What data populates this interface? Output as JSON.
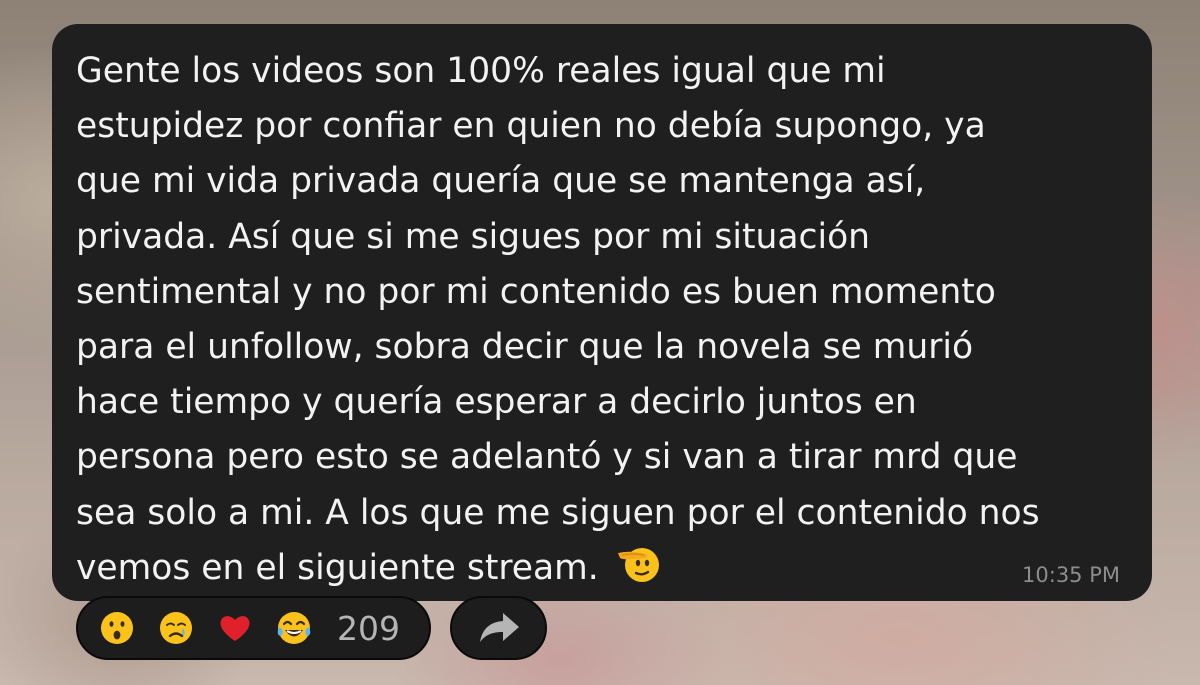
{
  "message": {
    "lines": [
      "Gente los videos son 100% reales igual que mi",
      "estupidez por confiar en quien no debía supongo, ya",
      "que mi vida privada quería que se mantenga así,",
      "privada. Así que si me sigues por mi situación",
      "sentimental y no por mi contenido es buen momento",
      "para el unfollow, sobra decir que la novela se murió",
      "hace tiempo y quería esperar a decirlo juntos en",
      "persona pero esto se adelantó y si van a tirar mrd que",
      "sea solo a mi. A los que me siguen por el contenido nos",
      "vemos en el siguiente stream."
    ],
    "trailing_emoji": "saluting-face-icon",
    "timestamp": "10:35 PM"
  },
  "reactions": {
    "items": [
      "surprised-face-icon",
      "crying-face-icon",
      "red-heart-icon",
      "tears-of-joy-icon"
    ],
    "count": "209"
  },
  "share": {
    "icon": "share-arrow-icon"
  },
  "colors": {
    "bubble": "#1f1f1f",
    "text": "#f2f2f2",
    "timestamp": "#8d8d8d",
    "pill": "#1d1d1d"
  }
}
